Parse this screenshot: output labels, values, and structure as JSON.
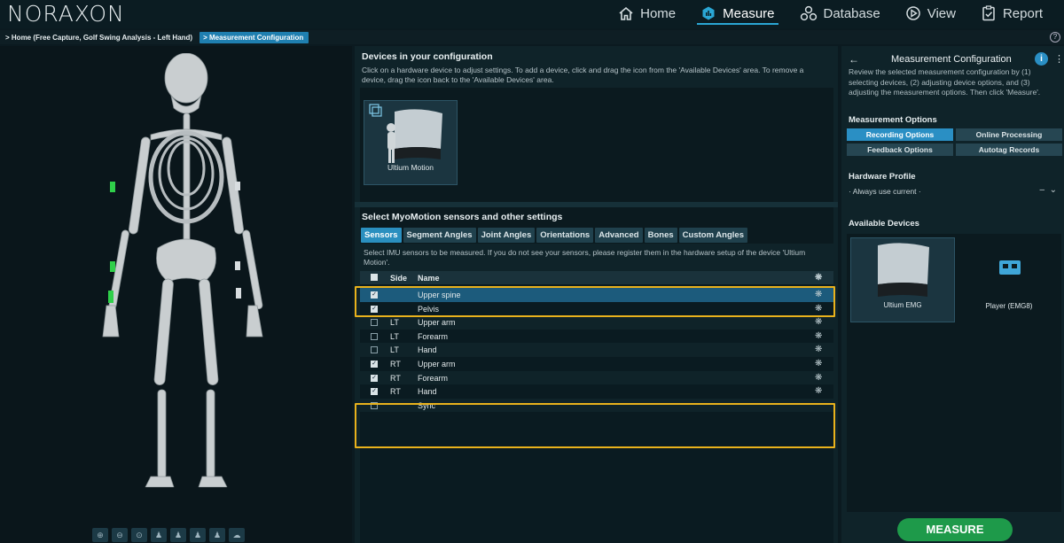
{
  "app": {
    "logo": "NORAXON",
    "nav": [
      {
        "label": "Home",
        "icon": "home-icon"
      },
      {
        "label": "Measure",
        "icon": "measure-icon"
      },
      {
        "label": "Database",
        "icon": "database-icon"
      },
      {
        "label": "View",
        "icon": "view-icon"
      },
      {
        "label": "Report",
        "icon": "report-icon"
      }
    ],
    "active_nav": "Measure",
    "accent": "#2aa6d4"
  },
  "breadcrumb": {
    "home": "Home (Free Capture, Golf Swing Analysis - Left Hand)",
    "current": "Measurement Configuration"
  },
  "devices": {
    "title": "Devices in your configuration",
    "description": "Click on a hardware device to adjust settings. To add a device, click and drag the icon from the 'Available Devices' area. To remove a device, drag the icon back to the 'Available Devices' area.",
    "items": [
      {
        "label": "Ultium Motion"
      }
    ]
  },
  "sensors": {
    "title": "Select MyoMotion sensors and other settings",
    "tabs": [
      "Sensors",
      "Segment Angles",
      "Joint Angles",
      "Orientations",
      "Advanced",
      "Bones",
      "Custom Angles"
    ],
    "active_tab": "Sensors",
    "description": "Select IMU sensors to be measured. If you do not see your sensors, please register them in the hardware setup of the device 'Ultium Motion'.",
    "columns": {
      "side": "Side",
      "name": "Name"
    },
    "rows": [
      {
        "checked": true,
        "side": "",
        "name": "Upper spine"
      },
      {
        "checked": true,
        "side": "",
        "name": "Pelvis"
      },
      {
        "checked": false,
        "side": "LT",
        "name": "Upper arm"
      },
      {
        "checked": false,
        "side": "LT",
        "name": "Forearm"
      },
      {
        "checked": false,
        "side": "LT",
        "name": "Hand"
      },
      {
        "checked": true,
        "side": "RT",
        "name": "Upper arm"
      },
      {
        "checked": true,
        "side": "RT",
        "name": "Forearm"
      },
      {
        "checked": true,
        "side": "RT",
        "name": "Hand"
      },
      {
        "checked": false,
        "side": "",
        "name": "Sync"
      }
    ],
    "highlight_color": "#e9b21c"
  },
  "config": {
    "title": "Measurement Configuration",
    "description": "Review the selected measurement configuration by (1) selecting devices, (2) adjusting device options, and (3) adjusting the measurement options. Then click 'Measure'.",
    "options_title": "Measurement Options",
    "options": [
      "Recording Options",
      "Online Processing",
      "Feedback Options",
      "Autotag Records"
    ],
    "active_option": "Recording Options",
    "profile_title": "Hardware Profile",
    "profile_value": "· Always use current ·",
    "available_title": "Available Devices",
    "available": [
      {
        "label": "Ultium EMG"
      },
      {
        "label": "Player (EMG8)"
      }
    ],
    "measure_label": "MEASURE",
    "measure_color": "#1e9a4a"
  }
}
